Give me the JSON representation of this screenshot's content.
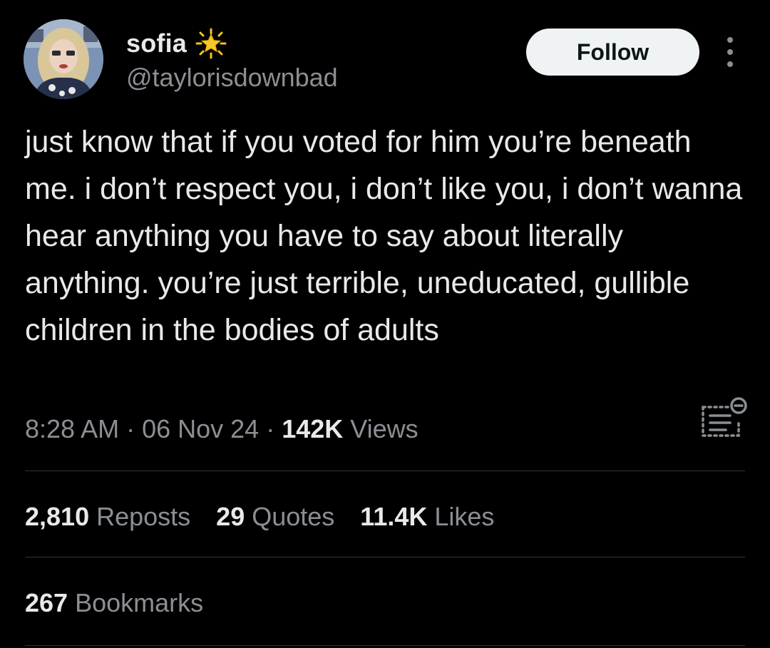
{
  "author": {
    "display_name": "sofia",
    "handle": "@taylorisdownbad",
    "avatar": "profile-photo",
    "badge": "star-emoji"
  },
  "actions": {
    "follow_label": "Follow",
    "more_icon": "more-vertical-icon"
  },
  "tweet": {
    "text": "just know that if you voted for him you’re beneath me. i don’t respect you, i don’t like you, i don’t wanna hear anything you have to say about literally anything. you’re just terrible, uneducated, gullible children in the bodies of adults",
    "time": "8:28 AM",
    "separator": " · ",
    "date": "06 Nov 24",
    "views_count": "142K",
    "views_label": " Views",
    "analytics_icon": "analytics-icon"
  },
  "stats": {
    "reposts": {
      "count": "2,810",
      "label": "Reposts"
    },
    "quotes": {
      "count": "29",
      "label": "Quotes"
    },
    "likes": {
      "count": "11.4K",
      "label": "Likes"
    },
    "bookmarks": {
      "count": "267",
      "label": "Bookmarks"
    }
  },
  "colors": {
    "background": "#000000",
    "text_primary": "#e7e9ea",
    "text_secondary": "#8b8f94",
    "divider": "#2f3336",
    "follow_button_bg": "#eff3f4",
    "follow_button_text": "#0f1419",
    "badge_star": "#f5c518"
  }
}
